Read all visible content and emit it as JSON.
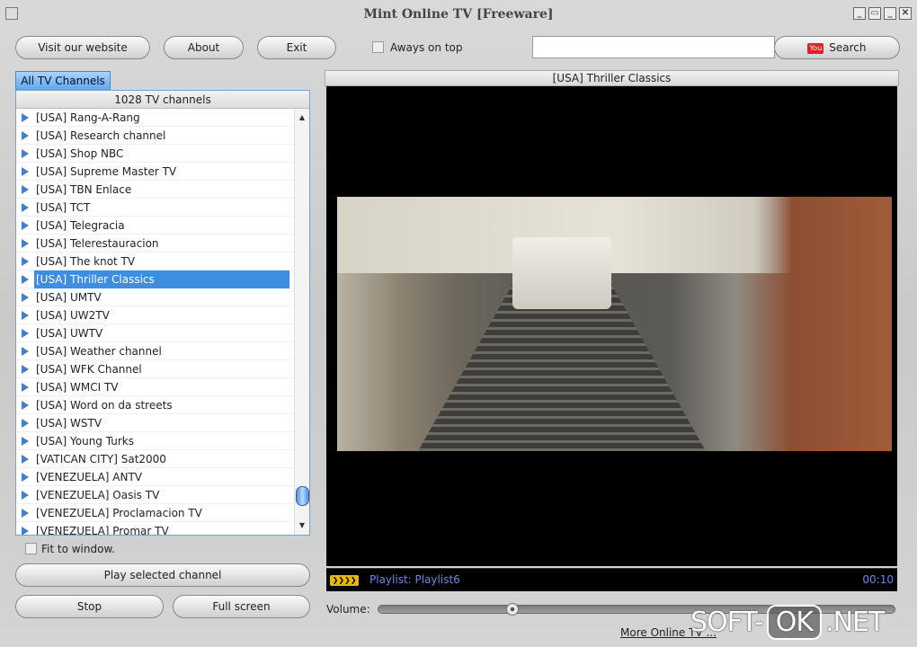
{
  "window": {
    "title": "Mint Online TV [Freeware]",
    "controls": [
      "_",
      "▭",
      "_",
      "✕"
    ]
  },
  "toolbar": {
    "visit": "Visit our website",
    "about": "About",
    "exit": "Exit",
    "always_on_top": "Aways on top",
    "always_on_top_checked": false,
    "search_value": "",
    "search_label": "Search",
    "search_icon": "youtube-icon",
    "youtube_text": "You"
  },
  "sidebar": {
    "tab": "All TV Channels",
    "count": "1028 TV channels",
    "channels": [
      "[USA] Rang-A-Rang",
      "[USA] Research channel",
      "[USA] Shop NBC",
      "[USA] Supreme Master TV",
      "[USA] TBN Enlace",
      "[USA] TCT",
      "[USA] Telegracia",
      "[USA] Telerestauracion",
      "[USA] The knot TV",
      "[USA] Thriller Classics",
      "[USA] UMTV",
      "[USA] UW2TV",
      "[USA] UWTV",
      "[USA] Weather channel",
      "[USA] WFK Channel",
      "[USA] WMCI TV",
      "[USA] Word on da streets",
      "[USA] WSTV",
      "[USA] Young Turks",
      "[VATICAN CITY] Sat2000",
      "[VENEZUELA] ANTV",
      "[VENEZUELA] Oasis TV",
      "[VENEZUELA] Proclamacion TV",
      "[VENEZUELA] Promar TV"
    ],
    "selected_index": 9,
    "fit_to_window": "Fit to window.",
    "fit_checked": false,
    "play": "Play selected channel",
    "stop": "Stop",
    "fullscreen": "Full screen"
  },
  "player": {
    "channel_title": "[USA] Thriller Classics",
    "playlist": "Playlist: Playlist6",
    "time": "00:10",
    "volume_label": "Volume:",
    "volume_fraction": 0.26,
    "status_color": "#6e87e8"
  },
  "footer": {
    "link": "More Online TV ..."
  },
  "watermark": {
    "a": "SOFT-",
    "b": "OK",
    ".c": "",
    "c": ".NET"
  }
}
